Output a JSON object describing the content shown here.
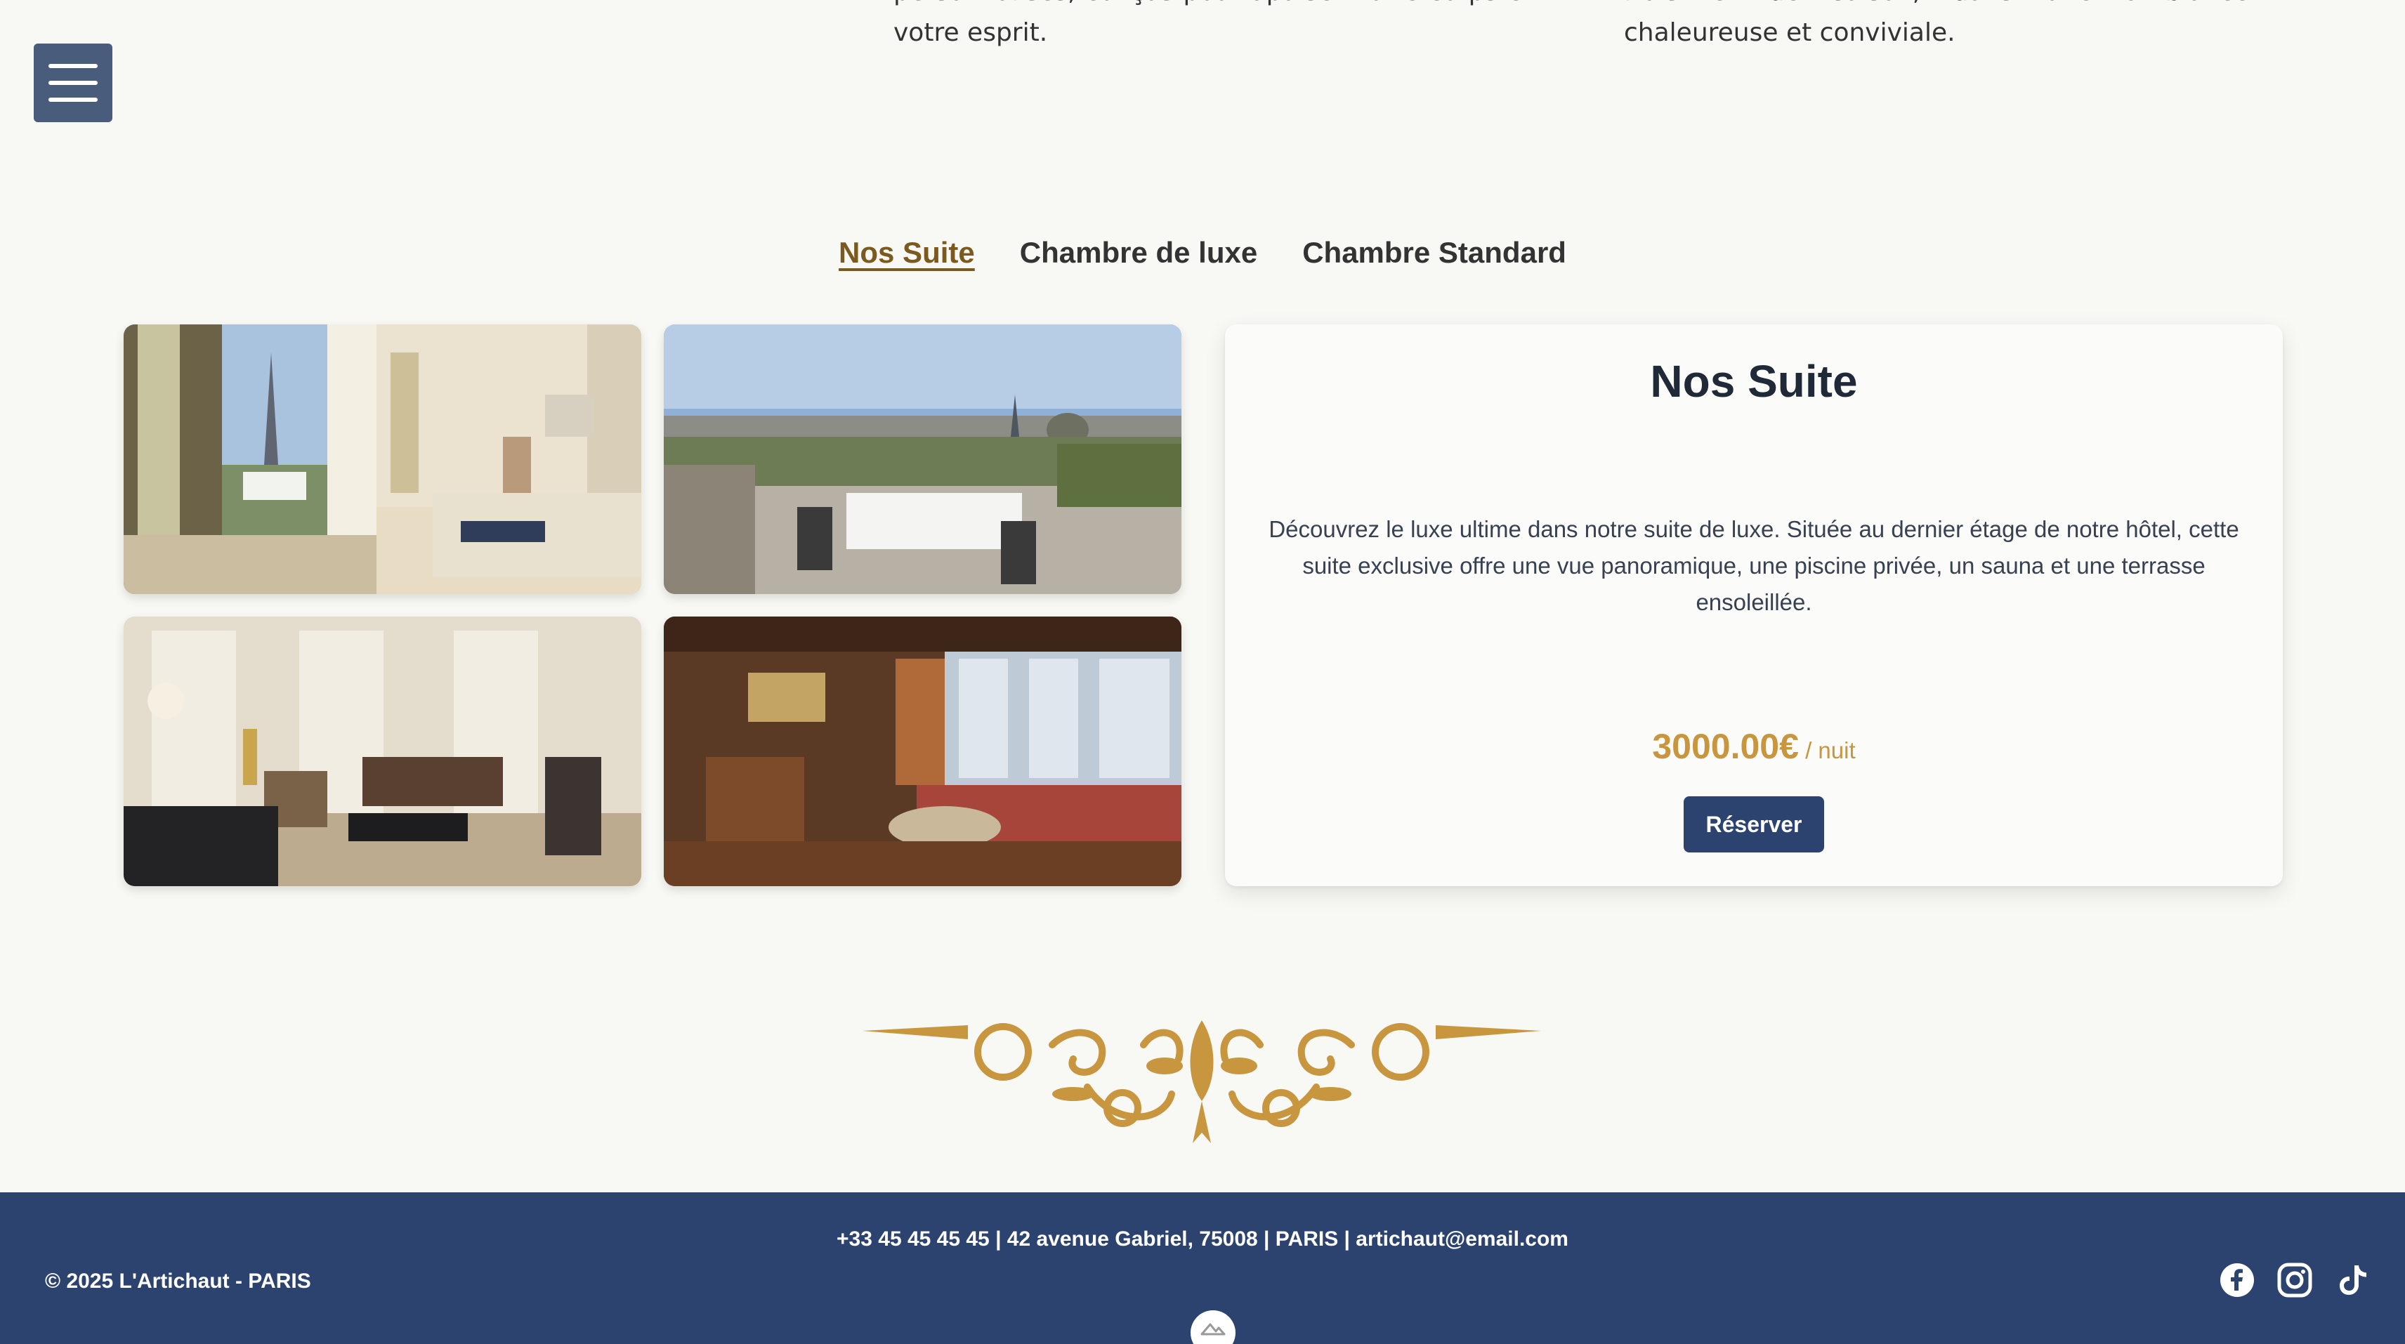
{
  "menu": {
    "icon": "hamburger-menu-icon"
  },
  "intro": {
    "left_text": "personnalisés, conçus pour apaiser votre corps et votre esprit.",
    "right_text": "frais et de saison, dans une ambiance chaleureuse et conviviale."
  },
  "tabs": [
    {
      "label": "Nos Suite",
      "active": true
    },
    {
      "label": "Chambre de luxe",
      "active": false
    },
    {
      "label": "Chambre Standard",
      "active": false
    }
  ],
  "gallery": {
    "photos": [
      {
        "subject": "suite bedroom with balcony view of Eiffel Tower"
      },
      {
        "subject": "rooftop terrace with dining table over Paris"
      },
      {
        "subject": "classic salon with sofas and desk"
      },
      {
        "subject": "round living room with red sofa and windows"
      }
    ]
  },
  "card": {
    "title": "Nos Suite",
    "description": "Découvrez le luxe ultime dans notre suite de luxe. Située au dernier étage de notre hôtel, cette suite exclusive offre une vue panoramique, une piscine privée, un sauna et une terrasse ensoleillée.",
    "price": "3000.00€",
    "price_unit": " / nuit",
    "reserve_label": "Réserver"
  },
  "colors": {
    "accent_gold": "#c8963e",
    "navy": "#2c4370",
    "active_tab": "#7a5a1e",
    "background": "#f8f8f4"
  },
  "footer": {
    "contact": "+33 45 45 45 45 | 42 avenue Gabriel, 75008 | PARIS | artichaut@email.com",
    "copyright": "© 2025 L'Artichaut - PARIS",
    "socials": [
      "facebook-icon",
      "instagram-icon",
      "tiktok-icon"
    ]
  }
}
